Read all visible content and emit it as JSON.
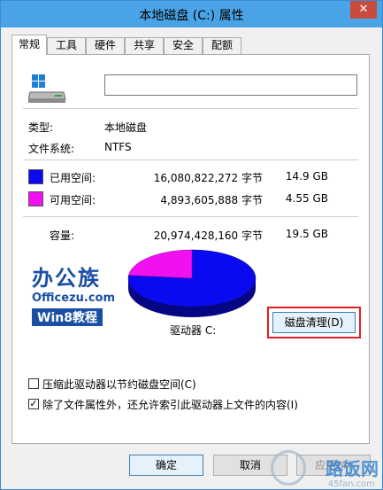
{
  "window": {
    "title": "本地磁盘 (C:) 属性",
    "close_glyph": "✕"
  },
  "tabs": [
    "常规",
    "工具",
    "硬件",
    "共享",
    "安全",
    "配额"
  ],
  "general": {
    "name_value": "",
    "type_label": "类型:",
    "type_value": "本地磁盘",
    "fs_label": "文件系统:",
    "fs_value": "NTFS",
    "used": {
      "label": "已用空间:",
      "bytes": "16,080,822,272 字节",
      "size": "14.9 GB",
      "color": "#0a0af0"
    },
    "free": {
      "label": "可用空间:",
      "bytes": "4,893,605,888 字节",
      "size": "4.55 GB",
      "color": "#f010f0"
    },
    "capacity": {
      "label": "容量:",
      "bytes": "20,974,428,160 字节",
      "size": "19.5 GB"
    },
    "drive_label": "驱动器 C:",
    "cleanup_button": "磁盘清理(D)",
    "compress_option": {
      "label": "压缩此驱动器以节约磁盘空间(C)",
      "checked": false
    },
    "index_option": {
      "label": "除了文件属性外，还允许索引此驱动器上文件的内容(I)",
      "checked": true,
      "check_glyph": "✓"
    }
  },
  "logo": {
    "line1": "办公族",
    "line2": "Officezu.com",
    "line3": "Win8教程"
  },
  "buttons": {
    "ok": "确定",
    "cancel": "取消",
    "apply": "应用(A)"
  },
  "watermark": {
    "text": "路饭网",
    "sub": "45fan.com"
  },
  "icons": {
    "drive": "hard-drive-icon",
    "close": "close-icon"
  },
  "chart_data": {
    "type": "pie",
    "categories": [
      "已用空间",
      "可用空间"
    ],
    "values": [
      16080822272,
      4893605888
    ],
    "colors": [
      "#0a0af0",
      "#f010f0"
    ]
  }
}
